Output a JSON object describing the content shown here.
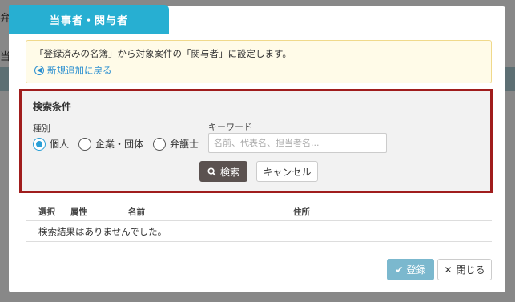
{
  "modal": {
    "title": "当事者・関与者",
    "notice_text": "「登録済みの名簿」から対象案件の「関与者」に設定します。",
    "back_link": "新規追加に戻る"
  },
  "search": {
    "title": "検索条件",
    "type_label": "種別",
    "types": [
      {
        "label": "個人",
        "checked": true
      },
      {
        "label": "企業・団体",
        "checked": false
      },
      {
        "label": "弁護士",
        "checked": false
      }
    ],
    "keyword_label": "キーワード",
    "keyword_placeholder": "名前、代表名、担当者名...",
    "keyword_value": "",
    "search_button": "検索",
    "cancel_button": "キャンセル"
  },
  "results": {
    "columns": [
      "選択",
      "属性",
      "名前",
      "住所"
    ],
    "empty_message": "検索結果はありませんでした。"
  },
  "footer": {
    "register_button": "登録",
    "close_button": "閉じる"
  },
  "background": {
    "fragments": [
      "弁",
      "当"
    ]
  },
  "colors": {
    "tab": "#27afd2",
    "search_border": "#a01d1d",
    "radio_checked": "#2a9fd6",
    "search_button": "#5b5250",
    "register_button": "#7bb8ce",
    "link": "#2a8fd0"
  }
}
